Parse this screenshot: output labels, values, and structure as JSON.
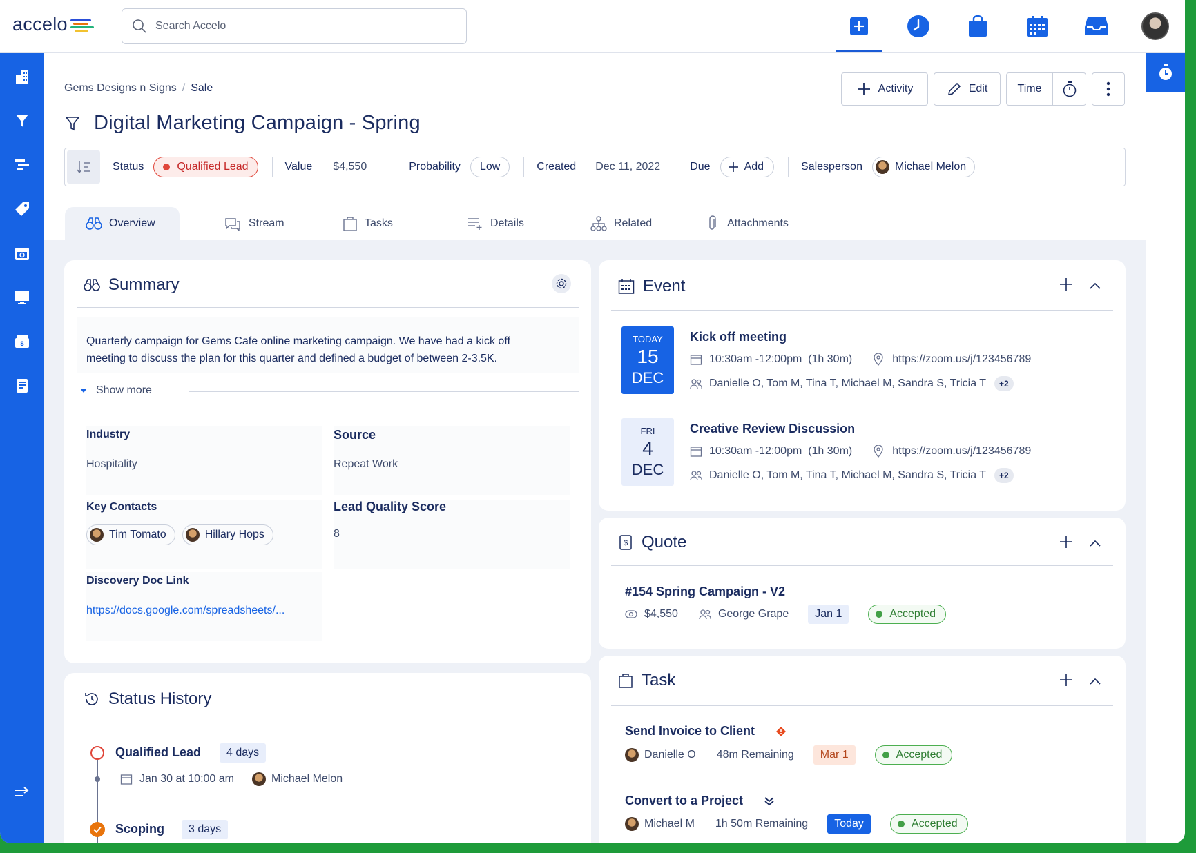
{
  "app": {
    "logo_text": "accelo",
    "search_placeholder": "Search Accelo",
    "topnav": [
      "plus-icon",
      "clock-icon",
      "bag-icon",
      "calendar-icon",
      "inbox-icon"
    ]
  },
  "breadcrumb": {
    "parent": "Gems Designs n Signs",
    "current": "Sale"
  },
  "title": "Digital Marketing Campaign - Spring",
  "actions": {
    "activity": "Activity",
    "edit": "Edit",
    "time": "Time"
  },
  "statusbar": {
    "status_label": "Status",
    "status_value": "Qualified Lead",
    "value_label": "Value",
    "value_currency": "$",
    "value_amount": "$4,550",
    "probability_label": "Probability",
    "probability_value": "Low",
    "created_label": "Created",
    "created_value": "Dec 11, 2022",
    "due_label": "Due",
    "due_add": "Add",
    "salesperson_label": "Salesperson",
    "salesperson_value": "Michael Melon"
  },
  "tabs": [
    "Overview",
    "Stream",
    "Tasks",
    "Details",
    "Related",
    "Attachments"
  ],
  "summary": {
    "title": "Summary",
    "description_line1": "Quarterly campaign for Gems Cafe online marketing campaign. We have had a kick off",
    "description_line2": "meeting to discuss the plan for this quarter and defined a budget of between 2-3.5K.",
    "show_more": "Show more",
    "industry_label": "Industry",
    "industry_value": "Hospitality",
    "source_label": "Source",
    "source_value": "Repeat Work",
    "key_contacts_label": "Key Contacts",
    "contacts": [
      "Tim Tomato",
      "Hillary Hops"
    ],
    "lead_score_label": "Lead Quality Score",
    "lead_score_value": "8",
    "discovery_label": "Discovery Doc Link",
    "discovery_value": "https://docs.google.com/spreadsheets/..."
  },
  "status_history": {
    "title": "Status History",
    "items": [
      {
        "status": "Qualified Lead",
        "duration": "4 days",
        "date": "Jan 30 at 10:00 am",
        "person": "Michael Melon"
      },
      {
        "status": "Scoping",
        "duration": "3 days"
      }
    ]
  },
  "event": {
    "title": "Event",
    "items": [
      {
        "day_label": "TODAY",
        "day": "15",
        "month": "DEC",
        "name": "Kick off meeting",
        "time": "10:30am -12:00pm  (1h 30m)",
        "location": "https://zoom.us/j/123456789",
        "attendees": "Danielle O, Tom M, Tina T, Michael M, Sandra S, Tricia T",
        "more": "+2"
      },
      {
        "day_label": "FRI",
        "day": "4",
        "month": "DEC",
        "name": "Creative Review Discussion",
        "time": "10:30am -12:00pm  (1h 30m)",
        "location": "https://zoom.us/j/123456789",
        "attendees": "Danielle O, Tom M, Tina T, Michael M, Sandra S, Tricia T",
        "more": "+2"
      }
    ]
  },
  "quote": {
    "title": "Quote",
    "name": "#154 Spring Campaign - V2",
    "amount": "$4,550",
    "person": "George Grape",
    "date": "Jan 1",
    "status": "Accepted"
  },
  "task": {
    "title": "Task",
    "items": [
      {
        "name": "Send Invoice to Client",
        "person": "Danielle O",
        "remaining": "48m Remaining",
        "date": "Mar 1",
        "status": "Accepted"
      },
      {
        "name": "Convert to a Project",
        "person": "Michael M",
        "remaining": "1h 50m Remaining",
        "date": "Today",
        "status": "Accepted"
      }
    ]
  },
  "colors": {
    "brand": "#1763e4",
    "navy": "#1a2b5f",
    "red": "#e0463a",
    "green": "#43a047",
    "orange": "#e8740c"
  }
}
